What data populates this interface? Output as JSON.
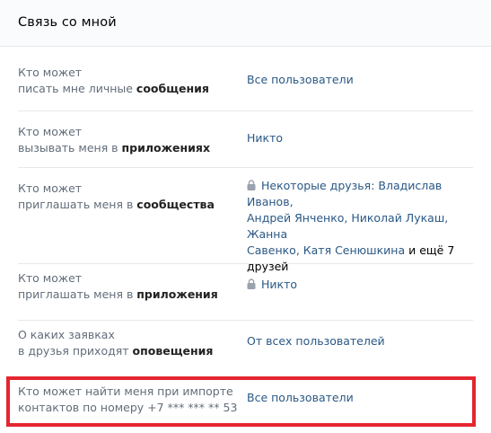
{
  "header": {
    "title": "Связь со мной"
  },
  "rows": [
    {
      "label_line1": "Кто может",
      "label_line2_prefix": "писать мне личные ",
      "label_line2_bold": "сообщения",
      "value": "Все пользователи"
    },
    {
      "label_line1": "Кто может",
      "label_line2_prefix": "вызывать меня в ",
      "label_line2_bold": "приложениях",
      "value": "Никто"
    },
    {
      "label_line1": "Кто может",
      "label_line2_prefix": "приглашать меня в ",
      "label_line2_bold": "сообщества",
      "value_line1": "Некоторые друзья: Владислав Иванов,",
      "value_line2": "Андрей Янченко, Николай Лукаш, Жанна",
      "value_line3_link": "Савенко, Катя Сенюшкина",
      "value_line3_plain": " и ещё 7",
      "value_line4_plain": "друзей",
      "locked": true
    },
    {
      "label_line1": "Кто может",
      "label_line2_prefix": "приглашать меня в ",
      "label_line2_bold": "приложения",
      "value": "Никто",
      "locked": true
    },
    {
      "label_line1": "О каких заявках",
      "label_line2_prefix": "в друзья приходят ",
      "label_line2_bold": "оповещения",
      "value": "От всех пользователей"
    },
    {
      "label_line1": "Кто может найти меня при импорте",
      "label_line2_prefix": "контактов по номеру +7 *** *** ** 53",
      "label_line2_bold": "",
      "value": "Все пользователи"
    }
  ],
  "colors": {
    "link": "#2a5885",
    "label": "#626d7a",
    "highlight": "#e3262f",
    "divider": "#e7e8ec"
  },
  "icons": {
    "lock": "lock-icon"
  }
}
